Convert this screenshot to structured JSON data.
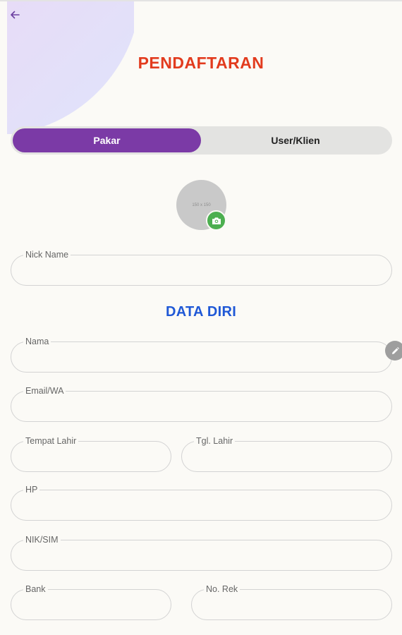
{
  "header": {
    "title": "PENDAFTARAN",
    "back_icon": "arrow-left-icon"
  },
  "tabs": {
    "items": [
      {
        "label": "Pakar",
        "active": true
      },
      {
        "label": "User/Klien",
        "active": false
      }
    ]
  },
  "avatar": {
    "placeholder_text": "150 x 150",
    "camera_icon": "camera-icon"
  },
  "form": {
    "nick_name": {
      "label": "Nick Name",
      "value": ""
    },
    "section_title": "DATA DIRI",
    "nama": {
      "label": "Nama",
      "value": ""
    },
    "email": {
      "label": "Email/WA",
      "value": ""
    },
    "tempat_lahir": {
      "label": "Tempat Lahir",
      "value": ""
    },
    "tgl_lahir": {
      "label": "Tgl. Lahir",
      "value": ""
    },
    "hp": {
      "label": "HP",
      "value": ""
    },
    "nik": {
      "label": "NIK/SIM",
      "value": ""
    },
    "bank": {
      "label": "Bank",
      "value": ""
    },
    "no_rek": {
      "label": "No. Rek",
      "value": ""
    }
  },
  "edit_button": {
    "icon": "pencil-icon"
  },
  "colors": {
    "title": "#e23b1e",
    "accent": "#7b3aa6",
    "section_title": "#1f58d6",
    "camera_button": "#4caf50",
    "background": "#fbfaf6"
  }
}
